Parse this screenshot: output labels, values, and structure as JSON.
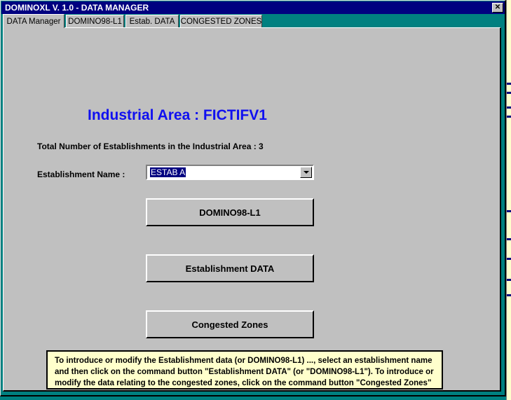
{
  "window": {
    "title": "DOMINOXL V. 1.0 - DATA MANAGER",
    "close_label": "✕"
  },
  "tabs": [
    {
      "label": "DATA Manager",
      "active": true
    },
    {
      "label": "DOMINO98-L1",
      "active": false
    },
    {
      "label": "Estab. DATA",
      "active": false
    },
    {
      "label": "CONGESTED ZONES",
      "active": false
    }
  ],
  "main": {
    "heading": "Industrial Area : FICTIFV1",
    "total_establishments_label": "Total Number of Establishments in the Industrial Area : 3",
    "establishment_name_label": "Establishment Name :",
    "combo": {
      "selected": "ESTAB A",
      "arrow_icon": "chevron-down-icon"
    },
    "buttons": {
      "domino": "DOMINO98-L1",
      "establishment_data": "Establishment DATA",
      "congested_zones": "Congested Zones"
    },
    "note": "To introduce or modify the Establishment data (or DOMINO98-L1) ..., select an establishment name and then click on the command button \"Establishment DATA\" (or \"DOMINO98-L1\").  To introduce or modify the data relating to the congested zones, click on the command button \"Congested Zones\""
  },
  "colors": {
    "desktop": "#008080",
    "titlebar": "#000080",
    "face": "#c0c0c0",
    "heading_blue": "#1010f0",
    "note_yellow": "#ffffcc"
  }
}
